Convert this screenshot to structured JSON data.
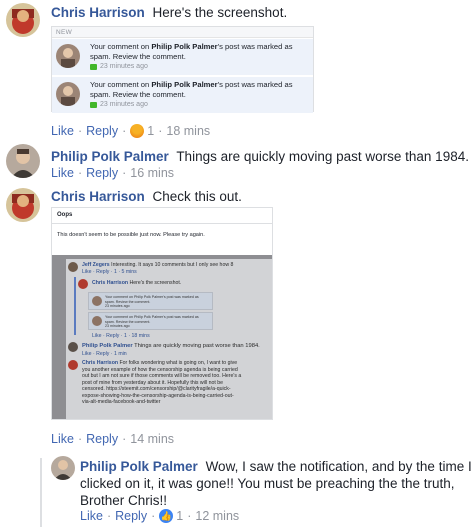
{
  "comments": [
    {
      "author": "Chris Harrison",
      "text": "Here's the screenshot.",
      "actions": {
        "like": "Like",
        "reply": "Reply",
        "reaction_count": "1",
        "time": "18 mins"
      }
    },
    {
      "author": "Philip Polk Palmer",
      "text": "Things are quickly moving past worse than 1984.",
      "actions": {
        "like": "Like",
        "reply": "Reply",
        "time": "16 mins"
      }
    },
    {
      "author": "Chris Harrison",
      "text": "Check this out.",
      "actions": {
        "like": "Like",
        "reply": "Reply",
        "time": "14 mins"
      }
    }
  ],
  "reply": {
    "author": "Philip Polk Palmer",
    "text_line1": "Wow, I saw the notification, and by the time I",
    "text_line2": "clicked on it, it was gone!! You must be preaching the the truth,",
    "text_line3": "Brother Chris!!",
    "actions": {
      "like": "Like",
      "reply": "Reply",
      "reaction_count": "1",
      "time": "12 mins"
    }
  },
  "notification_shot": {
    "header": "NEW",
    "items": [
      {
        "prefix": "Your comment on ",
        "name": "Philip Polk Palmer",
        "suffix": "'s post was marked as",
        "line2": "spam. Review the comment.",
        "time": "23 minutes ago"
      },
      {
        "prefix": "Your comment on ",
        "name": "Philip Polk Palmer",
        "suffix": "'s post was marked as",
        "line2": "spam. Review the comment.",
        "time": "23 minutes ago"
      }
    ]
  },
  "error_shot": {
    "title": "Oops",
    "message": "This doesn't seem to be possible just now. Please try again.",
    "inner": {
      "c1_name": "Jeff Zegers",
      "c1_text": "Interesting. It says 10 comments but I only see how 8",
      "c1_actions": "Like · Reply · 1 · 5 mins",
      "c2_name": "Chris Harrison",
      "c2_text": "Here's the screenshot.",
      "card_line1": "Your comment on Philip Polk Palmer's post was marked as",
      "card_line2": "spam. Review the comment.",
      "card_time": "23 minutes ago",
      "c2_actions": "Like · Reply · 1 · 18 mins",
      "c3_name": "Philip Polk Palmer",
      "c3_text": "Things are quickly moving past worse than 1984.",
      "c3_actions": "Like · Reply · 1 min",
      "c4_name": "Chris Harrison",
      "c4_lines": [
        "For folks wondering what is going on, I want to give",
        "you another example of how the censorship agenda is being carried",
        "out but I am not sure if those comments will be removed too. Here's a",
        "post of mine from yesterday about it. Hopefully this will not be",
        "censored. https://steemit.com/censorship/@clarityfragile/a-quick-",
        "expose-showing-how-the-censorship-agenda-is-being-carried-out-",
        "via-alt-media-facebook-and-twitter"
      ]
    }
  },
  "colors": {
    "link": "#365899",
    "action": "#4267b2",
    "meta": "#90949c"
  }
}
